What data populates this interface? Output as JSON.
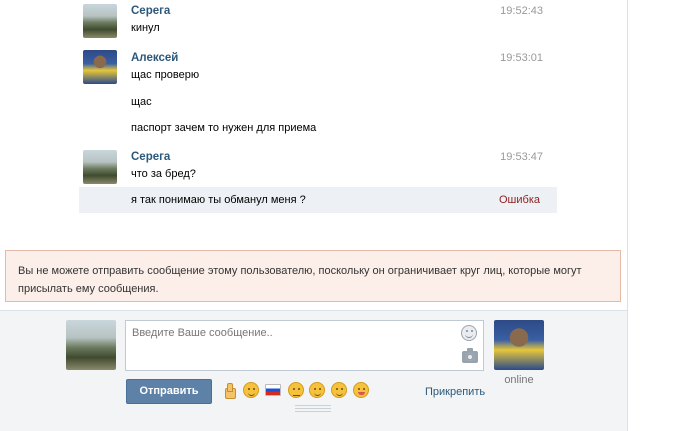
{
  "messages": [
    {
      "sender": "Серега",
      "time": "19:52:43",
      "lines": [
        "кинул"
      ],
      "avatar_icon": "user-avatar-serega"
    },
    {
      "sender": "Алексей",
      "time": "19:53:01",
      "lines": [
        "щас проверю",
        "щас",
        "паспорт зачем то нужен для приема"
      ],
      "avatar_icon": "user-avatar-aleksey"
    },
    {
      "sender": "Серега",
      "time": "19:53:47",
      "lines": [
        "что за бред?"
      ],
      "avatar_icon": "user-avatar-serega"
    }
  ],
  "failed_message": {
    "text": "я так понимаю ты обманул меня ?",
    "status": "Ошибка"
  },
  "notice": {
    "text": "Вы не можете отправить сообщение этому пользователю, поскольку он ограничивает круг лиц, которые могут присылать ему сообщения."
  },
  "composer": {
    "placeholder": "Введите Ваше сообщение..",
    "send_label": "Отправить",
    "attach_label": "Прикрепить",
    "online_label": "online",
    "emoji_icons": [
      "thumbs-up-icon",
      "wink-icon",
      "russia-flag-icon",
      "neutral-face-icon",
      "blush-face-icon",
      "grin-face-icon",
      "tongue-face-icon"
    ]
  },
  "colors": {
    "sender": "#2b587a",
    "error": "#8e1f1f",
    "send_button": "#5e81a8",
    "notice_bg": "#fcefe9"
  }
}
